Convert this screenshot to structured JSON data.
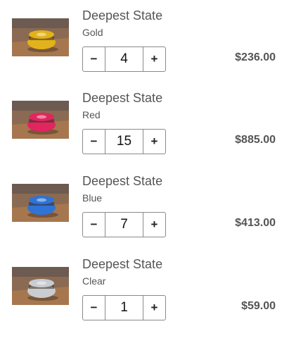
{
  "icons": {
    "decrement": "minus-icon",
    "increment": "plus-icon"
  },
  "colors": {
    "text": "#555555",
    "border": "#8a8a8a"
  },
  "cart": {
    "items": [
      {
        "title": "Deepest State",
        "variant": "Gold",
        "quantity": "4",
        "price": "$236.00",
        "minus_label": "−",
        "plus_label": "+",
        "product_color": "#e1b21c"
      },
      {
        "title": "Deepest State",
        "variant": "Red",
        "quantity": "15",
        "price": "$885.00",
        "minus_label": "−",
        "plus_label": "+",
        "product_color": "#e0265f"
      },
      {
        "title": "Deepest State",
        "variant": "Blue",
        "quantity": "7",
        "price": "$413.00",
        "minus_label": "−",
        "plus_label": "+",
        "product_color": "#2f73d6"
      },
      {
        "title": "Deepest State",
        "variant": "Clear",
        "quantity": "1",
        "price": "$59.00",
        "minus_label": "−",
        "plus_label": "+",
        "product_color": "#c9ccd0"
      }
    ]
  }
}
